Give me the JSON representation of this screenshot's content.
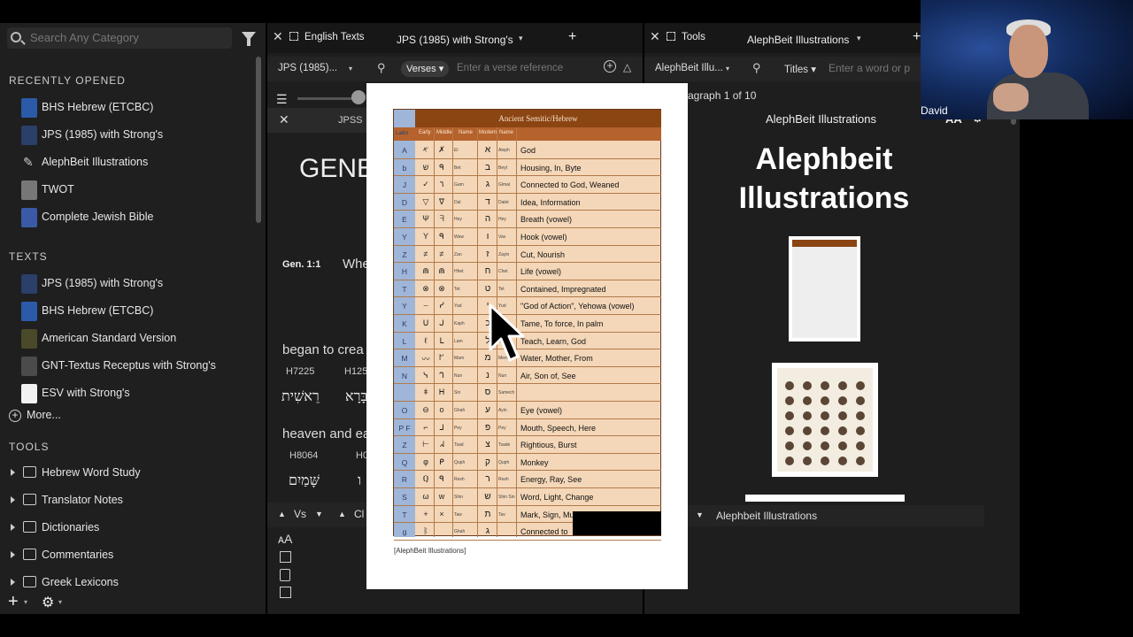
{
  "sidebar": {
    "search_placeholder": "Search Any Category",
    "recently_opened_header": "RECENTLY OPENED",
    "recent": [
      {
        "label": "BHS Hebrew (ETCBC)",
        "color": "#2b5aa8"
      },
      {
        "label": "JPS (1985) with Strong's",
        "color": "#2a3f6a"
      },
      {
        "label": "AlephBeit Illustrations",
        "color": ""
      },
      {
        "label": "TWOT",
        "color": "#777"
      },
      {
        "label": "Complete Jewish Bible",
        "color": "#3a5aa8"
      }
    ],
    "texts_header": "TEXTS",
    "texts": [
      {
        "label": "JPS (1985) with Strong's",
        "color": "#2a3f6a"
      },
      {
        "label": "BHS Hebrew (ETCBC)",
        "color": "#2b5aa8"
      },
      {
        "label": "American Standard Version",
        "color": "#4a4a2a"
      },
      {
        "label": "GNT-Textus Receptus with Strong's",
        "color": "#4b4b4b"
      },
      {
        "label": "ESV with Strong's",
        "color": "#f2f2f2"
      }
    ],
    "more_label": "More...",
    "tools_header": "TOOLS",
    "tools": [
      "Hebrew Word Study",
      "Translator Notes",
      "Dictionaries",
      "Commentaries",
      "Greek Lexicons"
    ]
  },
  "middle_pane": {
    "tab_label": "English Texts",
    "tab_title": "JPS (1985) with Strong's",
    "resource_dropdown": "JPS (1985)...",
    "mode_dropdown": "Verses",
    "verse_placeholder": "Enter a verse reference",
    "sub_tab": "JPSS",
    "book_heading": "GENE",
    "verse_ref": "Gen. 1:1",
    "verse_start": "Whe",
    "line1": "began to crea",
    "strongs1": "H7225",
    "strongs2": "H125",
    "hebrew1": "רֵאשִׁית",
    "hebrew2": "בָּרָא",
    "line2": "heaven and ea",
    "strongs3": "H8064",
    "strongs4": "H0",
    "hebrew3": "שָּׁמַיִם",
    "hebrew4": "ו",
    "footer_vs": "Vs",
    "footer_ch": "Cl"
  },
  "right_pane": {
    "tab_label": "Tools",
    "tab_title": "AlephBeit Illustrations",
    "resource_dropdown": "AlephBeit Illu...",
    "mode_dropdown": "Titles",
    "search_placeholder": "Enter a word or p",
    "paragraph_info": "agraph 1 of 10",
    "header_title": "AlephBeit Illustrations",
    "big_title": "Alephbeit Illustrations",
    "footer_title": "Alephbeit Illustrations",
    "text_size": "AA"
  },
  "popup": {
    "header": "Ancient Semitic/Hebrew",
    "subheaders": [
      "Latin",
      "Early",
      "Middle",
      "Name",
      "Modern",
      "Name"
    ],
    "rows": [
      {
        "latin": "A",
        "early": "𐤀",
        "mid": "✗",
        "name": "El",
        "heb": "א",
        "name2": "Aleph",
        "meaning": "God"
      },
      {
        "latin": "b",
        "early": "ש",
        "mid": "ᑫ",
        "name": "Bet",
        "heb": "ב",
        "name2": "Beyt",
        "meaning": "Housing, In, Byte"
      },
      {
        "latin": "J",
        "early": "✓",
        "mid": "٦",
        "name": "Gam",
        "heb": "ג",
        "name2": "Gimal",
        "meaning": "Connected to God, Weaned"
      },
      {
        "latin": "D",
        "early": "▽",
        "mid": "ᐁ",
        "name": "Dal",
        "heb": "ד",
        "name2": "Dalet",
        "meaning": "Idea, Information"
      },
      {
        "latin": "E",
        "early": "Ψ",
        "mid": "ᖷ",
        "name": "Hey",
        "heb": "ה",
        "name2": "Hey",
        "meaning": "Breath (vowel)"
      },
      {
        "latin": "Y",
        "early": "Y",
        "mid": "ᑫ",
        "name": "Waw",
        "heb": "ו",
        "name2": "Vav",
        "meaning": "Hook   (vowel)"
      },
      {
        "latin": "Z",
        "early": "≠",
        "mid": "≠",
        "name": "Zan",
        "heb": "ז",
        "name2": "Zayin",
        "meaning": "Cut, Nourish"
      },
      {
        "latin": "H",
        "early": "⋒",
        "mid": "⋒",
        "name": "Hhet",
        "heb": "ח",
        "name2": "Chet",
        "meaning": "Life      (vowel)"
      },
      {
        "latin": "T",
        "early": "⊗",
        "mid": "⊗",
        "name": "Tet",
        "heb": "ט",
        "name2": "Tet",
        "meaning": "Contained, Impregnated"
      },
      {
        "latin": "Y",
        "early": "⌣",
        "mid": "ᓯ",
        "name": "Yad",
        "heb": "י",
        "name2": "Yud",
        "meaning": "\"God of Action\", Yehowa   (vowel)"
      },
      {
        "latin": "K",
        "early": "Ս",
        "mid": "ᒍ",
        "name": "Kaph",
        "heb": "כ",
        "name2": "Kaph",
        "meaning": "Tame, To force, In palm"
      },
      {
        "latin": "L",
        "early": "ℓ",
        "mid": "ᒪ",
        "name": "Lam",
        "heb": "ל",
        "name2": "Lamed",
        "meaning": "Teach, Learn, God"
      },
      {
        "latin": "M",
        "early": "〰",
        "mid": "ᖸ",
        "name": "Mam",
        "heb": "מ",
        "name2": "Mem",
        "meaning": "Water, Mother, From"
      },
      {
        "latin": "N",
        "early": "ᓭ",
        "mid": "ᒉ",
        "name": "Nun",
        "heb": "נ",
        "name2": "Nun",
        "meaning": "Air, Son of, See"
      },
      {
        "latin": "",
        "early": "ǂ",
        "mid": "ᕼ",
        "name": "Sin",
        "heb": "ס",
        "name2": "Samech",
        "meaning": ""
      },
      {
        "latin": "O",
        "early": "⊖",
        "mid": "o",
        "name": "Ghah",
        "heb": "ע",
        "name2": "Ayin",
        "meaning": "Eye     (vowel)"
      },
      {
        "latin": "P F",
        "early": "⌐",
        "mid": "ᒧ",
        "name": "Pey",
        "heb": "פ",
        "name2": "Pey",
        "meaning": "Mouth, Speech, Here"
      },
      {
        "latin": "Z",
        "early": "⊢",
        "mid": "ᖽ",
        "name": "Tsad",
        "heb": "צ",
        "name2": "Tsade",
        "meaning": "Rightious, Burst"
      },
      {
        "latin": "Q",
        "early": "φ",
        "mid": "ᑭ",
        "name": "Quph",
        "heb": "ק",
        "name2": "Quph",
        "meaning": "Monkey"
      },
      {
        "latin": "R",
        "early": "ℚ",
        "mid": "ᑫ",
        "name": "Resh",
        "heb": "ר",
        "name2": "Resh",
        "meaning": "Energy, Ray, See"
      },
      {
        "latin": "S",
        "early": "ω",
        "mid": "w",
        "name": "Shin",
        "heb": "ש",
        "name2": "Shin Sin",
        "meaning": "Word, Light, Change"
      },
      {
        "latin": "T",
        "early": "+",
        "mid": "×",
        "name": "Taw",
        "heb": "ת",
        "name2": "Tav",
        "meaning": "Mark, Sign, Musical note, Thoth"
      },
      {
        "latin": "g",
        "early": "ᛒ",
        "mid": "",
        "name": "Ghah",
        "heb": "ג",
        "name2": "",
        "meaning": "Connected to"
      }
    ],
    "caption": "[AlephBeit Illustrations]"
  },
  "video": {
    "name": "David"
  }
}
